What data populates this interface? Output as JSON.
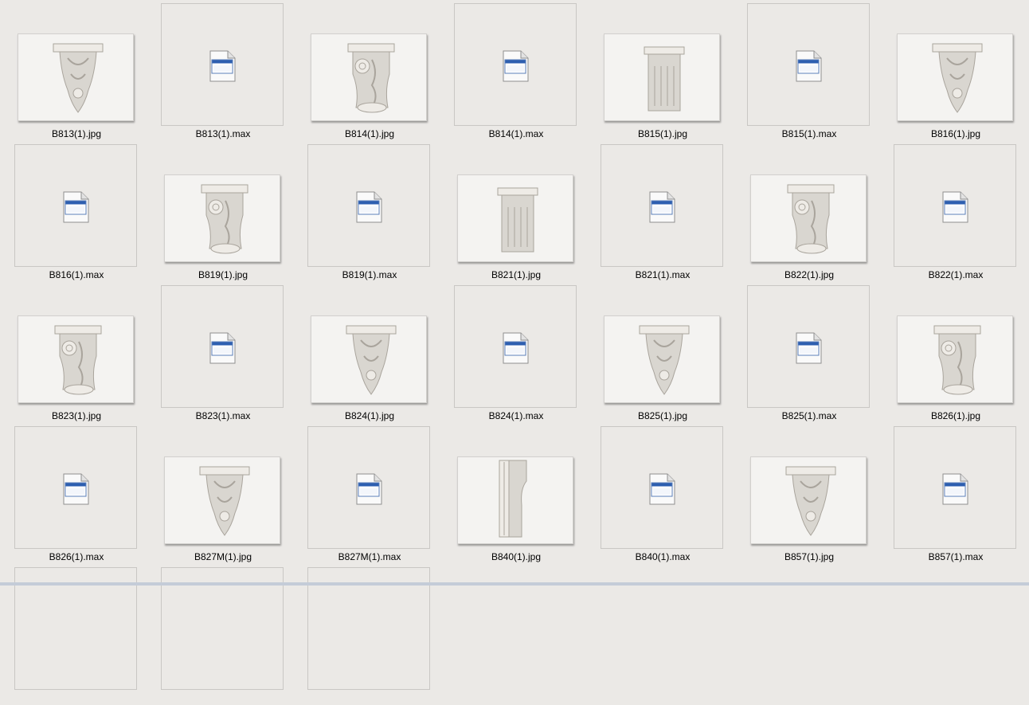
{
  "window": {
    "title": ""
  },
  "files": [
    {
      "name": "B813(1).jpg",
      "kind": "image",
      "shape": "ornate"
    },
    {
      "name": "B813(1).max",
      "kind": "max"
    },
    {
      "name": "B814(1).jpg",
      "kind": "image",
      "shape": "scroll"
    },
    {
      "name": "B814(1).max",
      "kind": "max"
    },
    {
      "name": "B815(1).jpg",
      "kind": "image",
      "shape": "fluted"
    },
    {
      "name": "B815(1).max",
      "kind": "max"
    },
    {
      "name": "B816(1).jpg",
      "kind": "image",
      "shape": "ornate"
    },
    {
      "name": "B816(1).max",
      "kind": "max"
    },
    {
      "name": "B819(1).jpg",
      "kind": "image",
      "shape": "scroll"
    },
    {
      "name": "B819(1).max",
      "kind": "max"
    },
    {
      "name": "B821(1).jpg",
      "kind": "image",
      "shape": "fluted"
    },
    {
      "name": "B821(1).max",
      "kind": "max"
    },
    {
      "name": "B822(1).jpg",
      "kind": "image",
      "shape": "scroll"
    },
    {
      "name": "B822(1).max",
      "kind": "max"
    },
    {
      "name": "B823(1).jpg",
      "kind": "image",
      "shape": "scroll"
    },
    {
      "name": "B823(1).max",
      "kind": "max"
    },
    {
      "name": "B824(1).jpg",
      "kind": "image",
      "shape": "ornate"
    },
    {
      "name": "B824(1).max",
      "kind": "max"
    },
    {
      "name": "B825(1).jpg",
      "kind": "image",
      "shape": "ornate"
    },
    {
      "name": "B825(1).max",
      "kind": "max"
    },
    {
      "name": "B826(1).jpg",
      "kind": "image",
      "shape": "scroll"
    },
    {
      "name": "B826(1).max",
      "kind": "max"
    },
    {
      "name": "B827M(1).jpg",
      "kind": "image",
      "shape": "ornate"
    },
    {
      "name": "B827M(1).max",
      "kind": "max"
    },
    {
      "name": "B840(1).jpg",
      "kind": "image",
      "shape": "plain"
    },
    {
      "name": "B840(1).max",
      "kind": "max"
    },
    {
      "name": "B857(1).jpg",
      "kind": "image",
      "shape": "ornate"
    },
    {
      "name": "B857(1).max",
      "kind": "max"
    },
    {
      "name": "",
      "kind": "partial"
    },
    {
      "name": "",
      "kind": "partial"
    },
    {
      "name": "",
      "kind": "partial"
    }
  ],
  "colors": {
    "background": "#ebe9e6",
    "frame_border": "#c9c7c4",
    "icon_blue": "#2d5fb0"
  }
}
